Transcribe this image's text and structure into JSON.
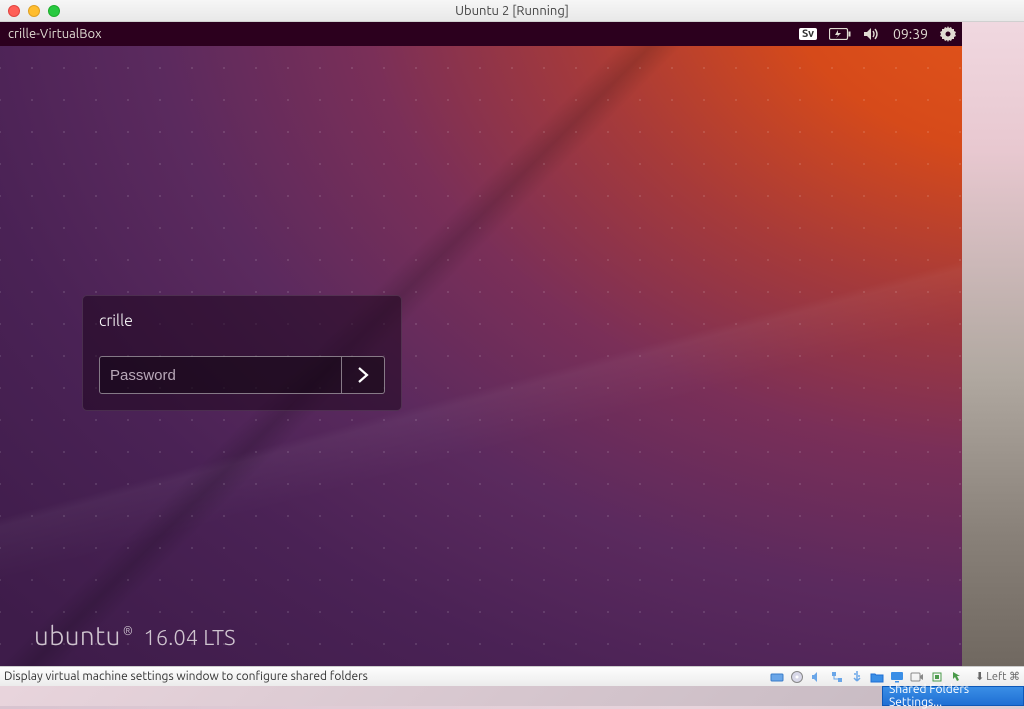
{
  "window": {
    "title": "Ubuntu 2 [Running]"
  },
  "ubuntu_topbar": {
    "hostname": "crille-VirtualBox",
    "keyboard_indicator": "Sv",
    "clock": "09:39"
  },
  "login": {
    "username": "crille",
    "password_placeholder": "Password"
  },
  "branding": {
    "word": "ubuntu",
    "mark": "®",
    "version": "16.04 LTS"
  },
  "vb_status": {
    "hint": "Display virtual machine settings window to configure shared folders",
    "host_key_arrow": "⬇",
    "host_key_label": "Left ⌘"
  },
  "tooltip": {
    "label": "Shared Folders Settings..."
  }
}
